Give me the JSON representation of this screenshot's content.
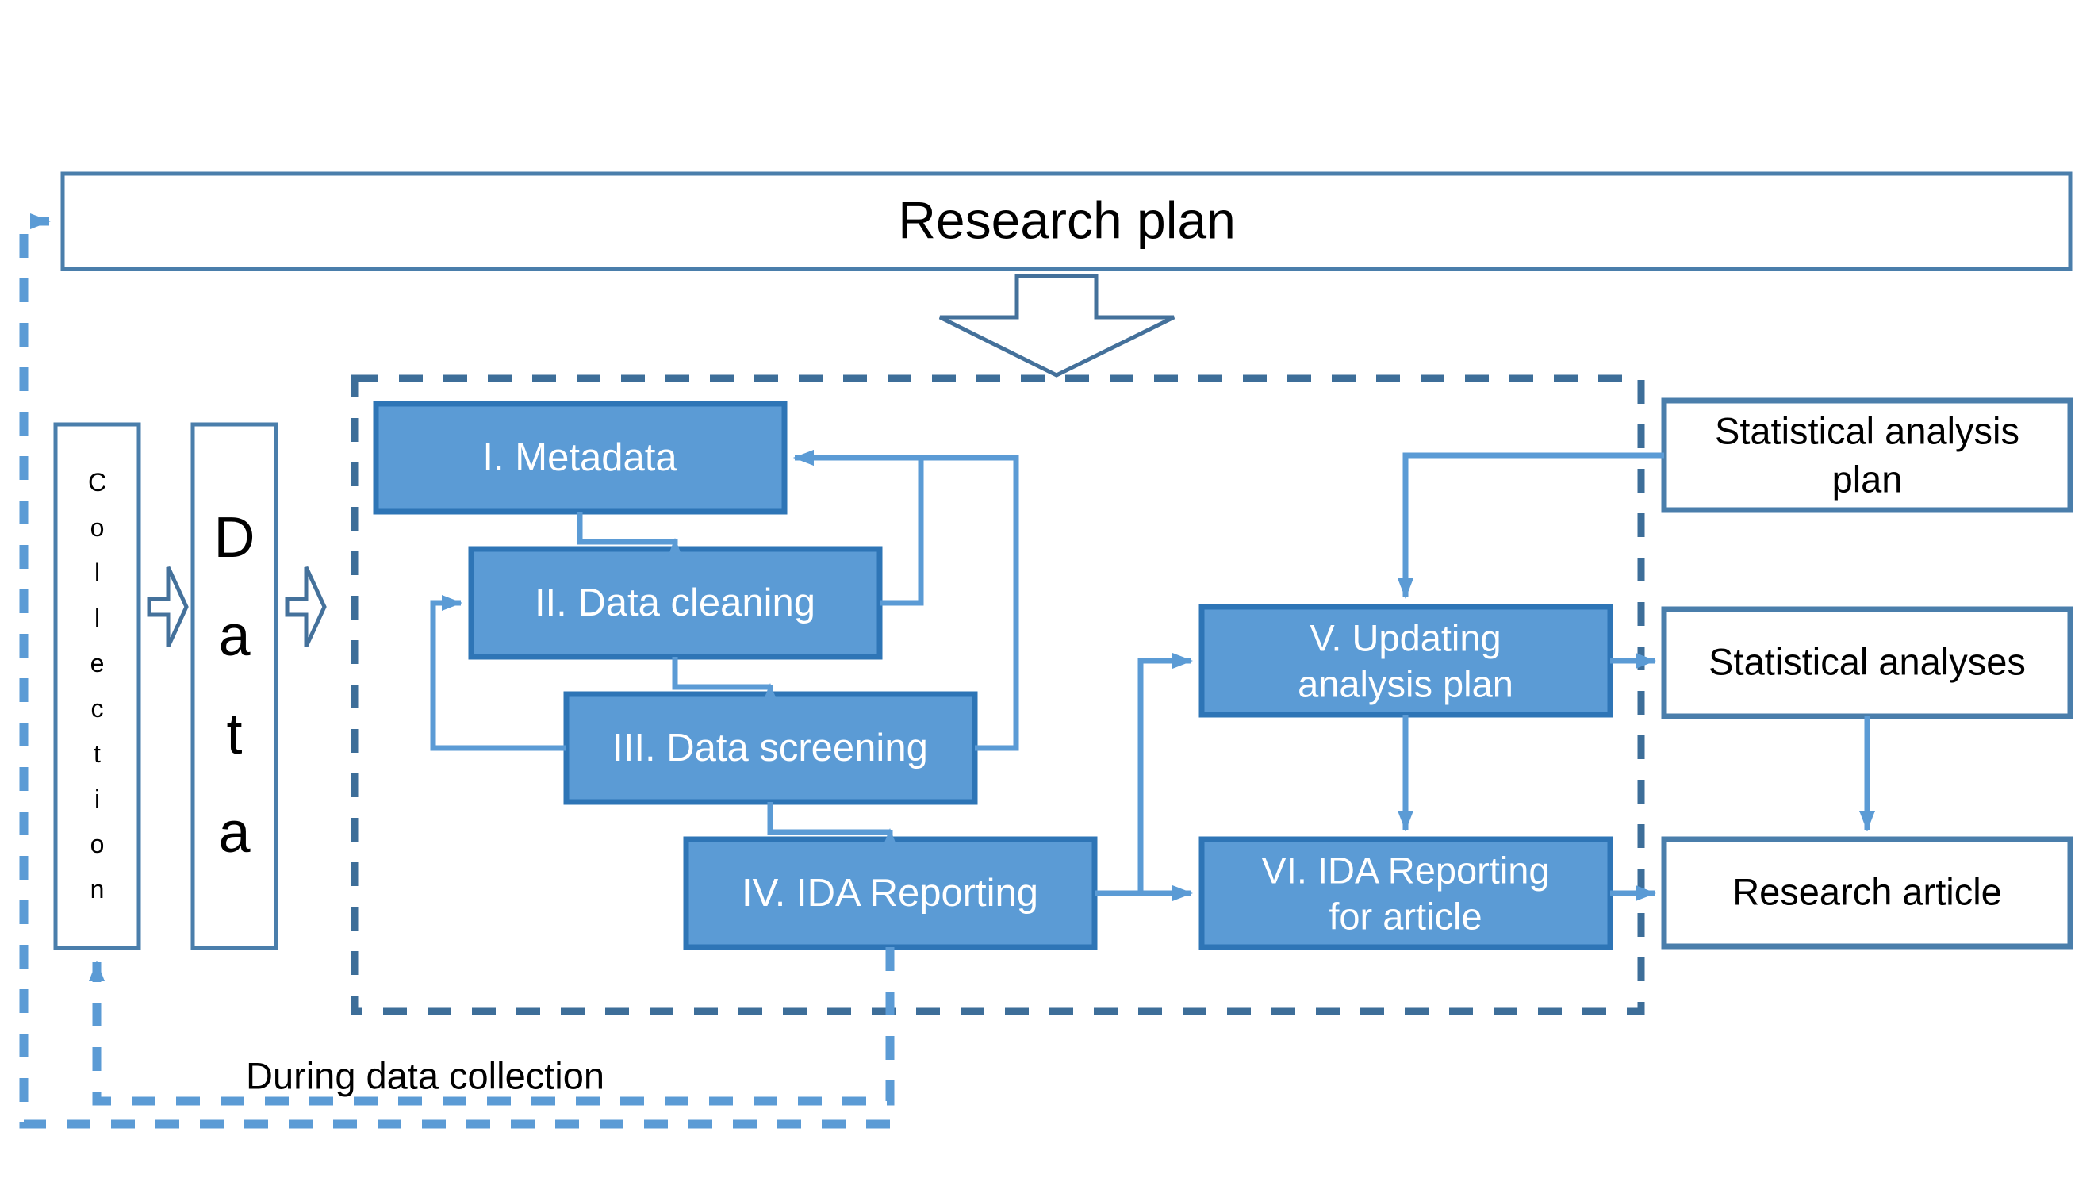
{
  "diagram": {
    "title": "Research plan",
    "caption": "During data collection",
    "colors": {
      "box_fill_blue": "#5B9BD5",
      "box_stroke_blue": "#2E75B6",
      "box_fill_white": "#FFFFFF",
      "box_stroke_outline": "#3D74A5",
      "connector_blue": "#5B9BD5",
      "dashed_blue": "#4A90C4",
      "container_dashed": "#3D6E99",
      "text_white": "#FFFFFF",
      "text_black": "#000000"
    },
    "header": {
      "label": "Research plan"
    },
    "input_boxes": [
      {
        "id": "collection",
        "label": "Collection",
        "letters": [
          "C",
          "o",
          "l",
          "l",
          "e",
          "c",
          "t",
          "i",
          "o",
          "n"
        ],
        "orientation": "vertical-stacked"
      },
      {
        "id": "data",
        "label": "Data",
        "letters": [
          "D",
          "a",
          "t",
          "a"
        ],
        "orientation": "vertical-stacked"
      }
    ],
    "ida_steps": [
      {
        "id": "step-1",
        "label": "I. Metadata"
      },
      {
        "id": "step-2",
        "label": "II. Data cleaning"
      },
      {
        "id": "step-3",
        "label": "III. Data screening"
      },
      {
        "id": "step-4",
        "label": "IV. IDA Reporting"
      },
      {
        "id": "step-5",
        "label": "V. Updating\nanalysis plan",
        "line1": "V. Updating",
        "line2": "analysis plan"
      },
      {
        "id": "step-6",
        "label": "VI. IDA Reporting\nfor article",
        "line1": "VI. IDA Reporting",
        "line2": "for article"
      }
    ],
    "outputs": [
      {
        "id": "stat-analysis-plan",
        "line1": "Statistical analysis",
        "line2": "plan"
      },
      {
        "id": "stat-analyses",
        "line1": "Statistical analyses",
        "line2": ""
      },
      {
        "id": "research-article",
        "line1": "Research article",
        "line2": ""
      }
    ],
    "footnote": {
      "label": "During data collection"
    },
    "arrows": {
      "block_arrow_down": "block-arrow-down",
      "chevron_right_1": "chevron-arrow-right",
      "chevron_right_2": "chevron-arrow-right"
    }
  }
}
